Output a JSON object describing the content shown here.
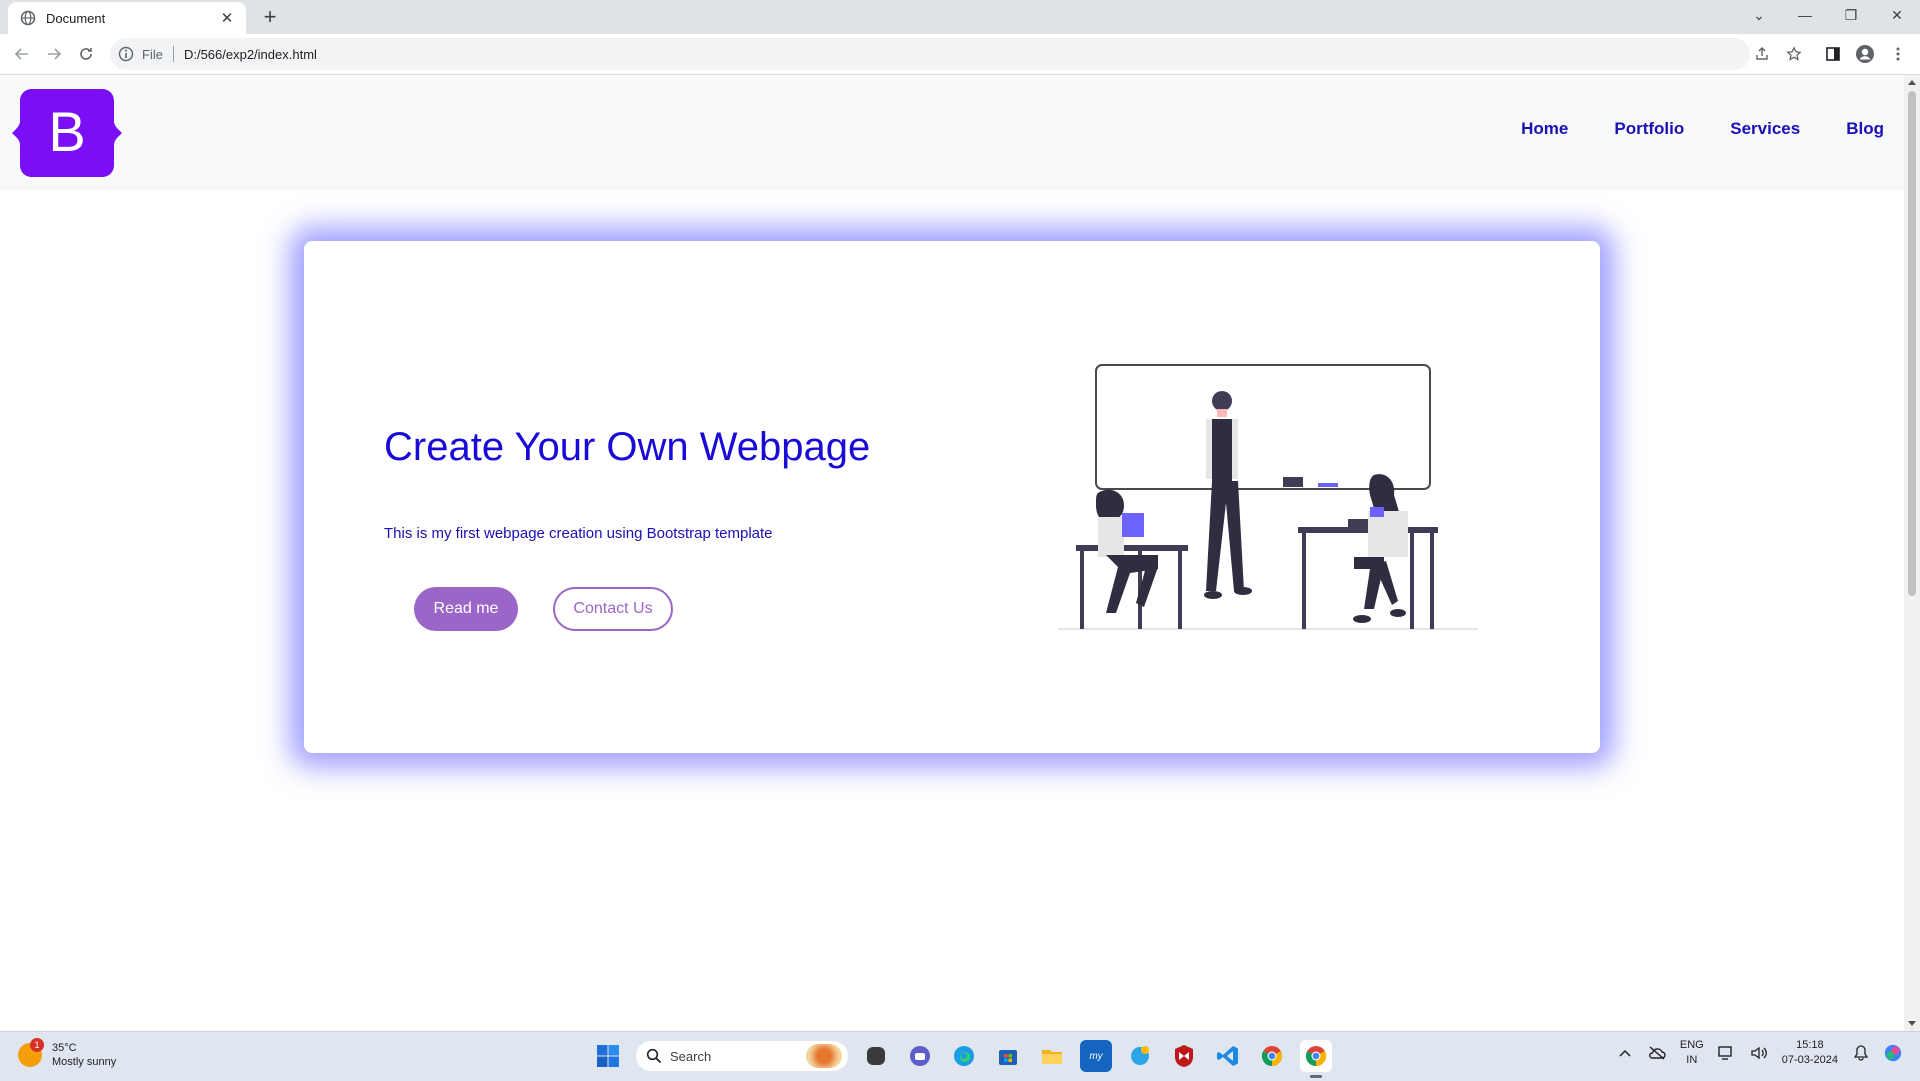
{
  "browser": {
    "tab_title": "Document",
    "scheme_label": "File",
    "url": "D:/566/exp2/index.html"
  },
  "site": {
    "brand_letter": "B",
    "nav": [
      "Home",
      "Portfolio",
      "Services",
      "Blog"
    ],
    "hero": {
      "title": "Create Your Own Webpage",
      "subtitle": "This is my first webpage creation using Bootstrap template",
      "primary_button": "Read me",
      "secondary_button": "Contact Us"
    },
    "colors": {
      "nav_link": "#1a10b5",
      "title": "#1a0ad8",
      "button_accent": "#9c66c9",
      "brand": "#7a0ff5",
      "card_glow": "#5050ff"
    }
  },
  "taskbar": {
    "weather_temp": "35°C",
    "weather_desc": "Mostly sunny",
    "weather_badge": "1",
    "search_label": "Search",
    "lang_top": "ENG",
    "lang_bottom": "IN",
    "time": "15:18",
    "date": "07-03-2024",
    "app_icons": [
      "file-explorer-icon",
      "teams-chat-icon",
      "edge-icon",
      "store-icon",
      "folder-icon",
      "mail-app-icon",
      "weather-app-icon",
      "mcafee-icon",
      "vscode-icon",
      "chrome-icon",
      "chrome-active-icon"
    ]
  }
}
